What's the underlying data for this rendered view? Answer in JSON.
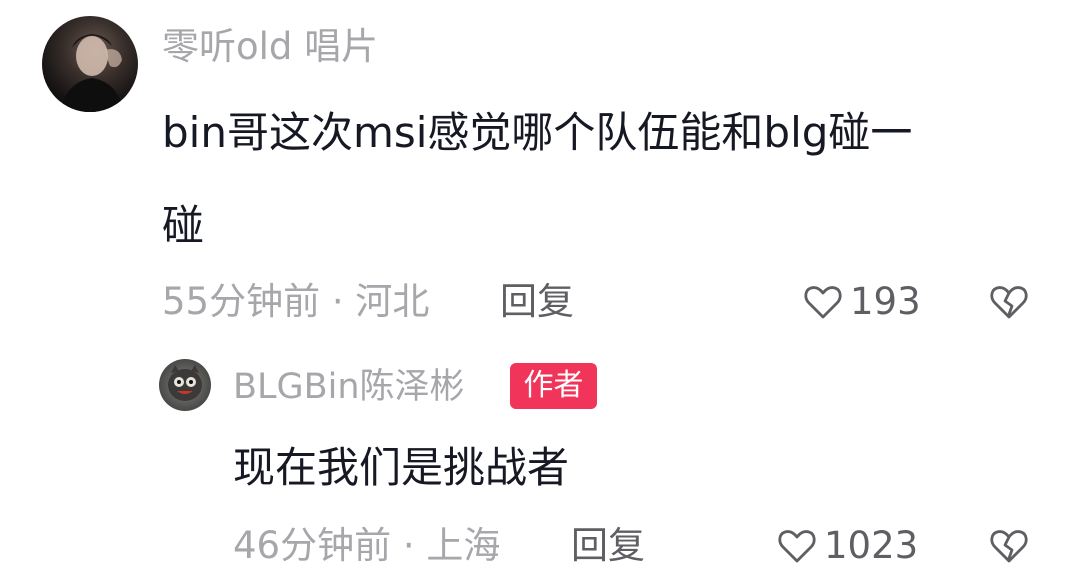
{
  "comment": {
    "username": "零听old 唱片",
    "text_line1": "bin哥这次msi感觉哪个队伍能和blg碰一",
    "text_line2": "碰",
    "meta": "55分钟前 · 河北",
    "reply_label": "回复",
    "like_count": "193",
    "like_icon": "heart-outline-icon",
    "dislike_icon": "broken-heart-icon",
    "avatar": "user-avatar"
  },
  "reply": {
    "username": "BLGBin陈泽彬",
    "author_badge": "作者",
    "text": "现在我们是挑战者",
    "meta": "46分钟前 · 上海",
    "reply_label": "回复",
    "like_count": "1023",
    "like_icon": "heart-outline-icon",
    "dislike_icon": "broken-heart-icon",
    "avatar": "author-avatar"
  },
  "colors": {
    "primary_text": "#161823",
    "secondary_text": "#a6a6ab",
    "action_text": "#5e5e63",
    "badge_bg": "#f0345a",
    "badge_text": "#ffffff"
  }
}
